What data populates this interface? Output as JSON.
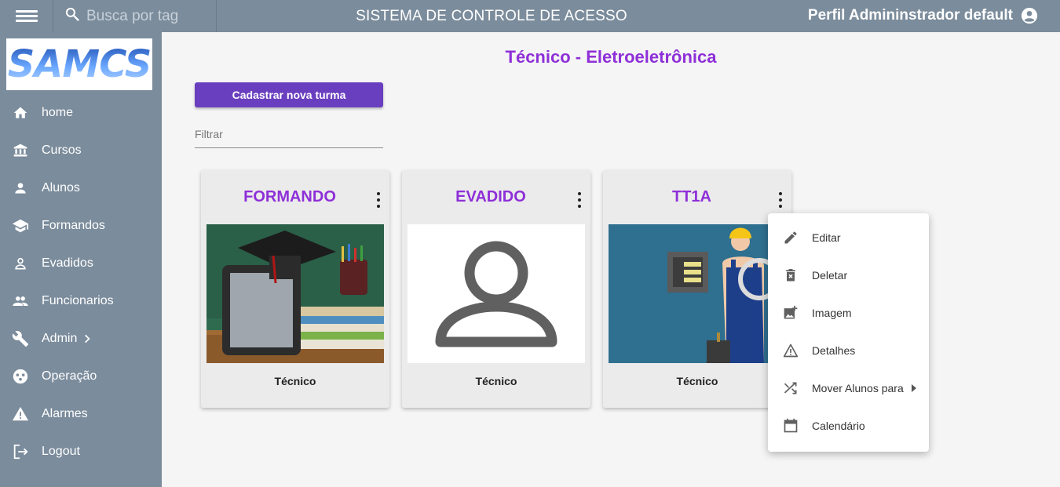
{
  "topbar": {
    "search_placeholder": "Busca por tag",
    "app_title": "SISTEMA DE CONTROLE DE ACESSO",
    "profile_label": "Perfil Admininstrador default"
  },
  "sidebar": {
    "logo_text": "SAMCS",
    "items": [
      {
        "label": "home",
        "icon": "home-icon"
      },
      {
        "label": "Cursos",
        "icon": "institution-icon"
      },
      {
        "label": "Alunos",
        "icon": "person-icon"
      },
      {
        "label": "Formandos",
        "icon": "graduation-cap-icon"
      },
      {
        "label": "Evadidos",
        "icon": "person-outline-icon"
      },
      {
        "label": "Funcionarios",
        "icon": "people-icon"
      },
      {
        "label": "Admin",
        "icon": "wrench-icon"
      },
      {
        "label": "Operação",
        "icon": "operation-icon"
      },
      {
        "label": "Alarmes",
        "icon": "warning-icon"
      },
      {
        "label": "Logout",
        "icon": "logout-icon"
      }
    ]
  },
  "main": {
    "page_title": "Técnico - Eletroeletrônica",
    "new_class_button": "Cadastrar nova turma",
    "filter_placeholder": "Filtrar",
    "cards": [
      {
        "title": "FORMANDO",
        "subtitle": "Técnico",
        "image": "graduation-photo"
      },
      {
        "title": "EVADIDO",
        "subtitle": "Técnico",
        "image": "person-placeholder"
      },
      {
        "title": "TT1A",
        "subtitle": "Técnico",
        "image": "electrician-illustration"
      }
    ]
  },
  "context_menu": {
    "items": [
      {
        "label": "Editar",
        "icon": "edit-icon"
      },
      {
        "label": "Deletar",
        "icon": "delete-icon"
      },
      {
        "label": "Imagem",
        "icon": "add-image-icon"
      },
      {
        "label": "Detalhes",
        "icon": "warning-outline-icon"
      },
      {
        "label": "Mover Alunos para",
        "icon": "shuffle-icon"
      },
      {
        "label": "Calendário",
        "icon": "calendar-icon"
      }
    ]
  }
}
